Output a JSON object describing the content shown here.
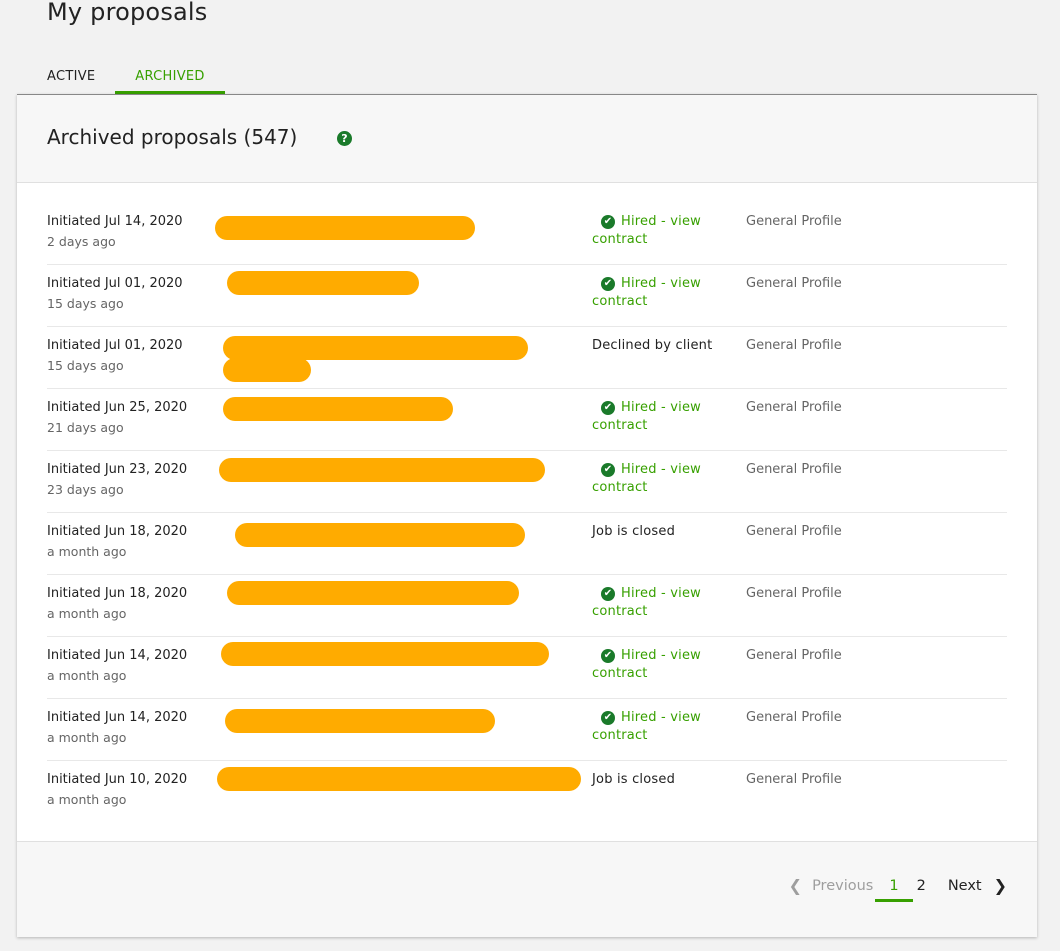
{
  "page": {
    "title": "My proposals"
  },
  "tabs": {
    "active": "ACTIVE",
    "archived": "ARCHIVED"
  },
  "card": {
    "title": "Archived proposals (547)",
    "help_icon": "help-circle-icon"
  },
  "proposals": [
    {
      "date": "Initiated Jul 14, 2020",
      "ago": "2 days ago",
      "status_type": "hired",
      "status": "Hired - view contract",
      "profile": "General Profile"
    },
    {
      "date": "Initiated Jul 01, 2020",
      "ago": "15 days ago",
      "status_type": "hired",
      "status": "Hired - view contract",
      "profile": "General Profile"
    },
    {
      "date": "Initiated Jul 01, 2020",
      "ago": "15 days ago",
      "status_type": "plain",
      "status": "Declined by client",
      "profile": "General Profile"
    },
    {
      "date": "Initiated Jun 25, 2020",
      "ago": "21 days ago",
      "status_type": "hired",
      "status": "Hired - view contract",
      "profile": "General Profile"
    },
    {
      "date": "Initiated Jun 23, 2020",
      "ago": "23 days ago",
      "status_type": "hired",
      "status": "Hired - view contract",
      "profile": "General Profile"
    },
    {
      "date": "Initiated Jun 18, 2020",
      "ago": "a month ago",
      "status_type": "plain",
      "status": "Job is closed",
      "profile": "General Profile"
    },
    {
      "date": "Initiated Jun 18, 2020",
      "ago": "a month ago",
      "status_type": "hired",
      "status": "Hired - view contract",
      "profile": "General Profile"
    },
    {
      "date": "Initiated Jun 14, 2020",
      "ago": "a month ago",
      "status_type": "hired",
      "status": "Hired - view contract",
      "profile": "General Profile"
    },
    {
      "date": "Initiated Jun 14, 2020",
      "ago": "a month ago",
      "status_type": "hired",
      "status": "Hired - view contract",
      "profile": "General Profile"
    },
    {
      "date": "Initiated Jun 10, 2020",
      "ago": "a month ago",
      "status_type": "plain",
      "status": "Job is closed",
      "profile": "General Profile"
    }
  ],
  "pagination": {
    "previous": "Previous",
    "pages": [
      "1",
      "2"
    ],
    "current": "1",
    "next": "Next"
  },
  "colors": {
    "accent": "#37a000",
    "redaction": "#ffab00",
    "check": "#1a7a2a"
  }
}
